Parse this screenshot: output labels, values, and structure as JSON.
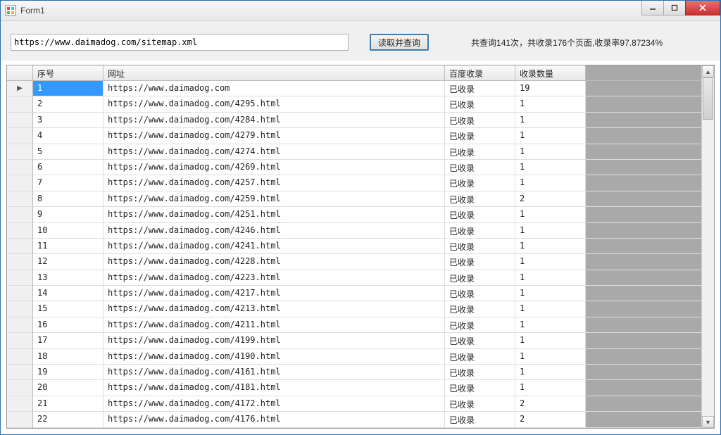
{
  "window": {
    "title": "Form1"
  },
  "toolbar": {
    "url_value": "https://www.daimadog.com/sitemap.xml",
    "read_btn": "读取并查询",
    "status": "共查询141次，共收录176个页面,收录率97.87234%"
  },
  "grid": {
    "headers": {
      "idx": "序号",
      "url": "网址",
      "status": "百度收录",
      "count": "收录数量"
    },
    "rows": [
      {
        "idx": "1",
        "url": "https://www.daimadog.com",
        "status": "已收录",
        "count": "19",
        "selected": true
      },
      {
        "idx": "2",
        "url": "https://www.daimadog.com/4295.html",
        "status": "已收录",
        "count": "1"
      },
      {
        "idx": "3",
        "url": "https://www.daimadog.com/4284.html",
        "status": "已收录",
        "count": "1"
      },
      {
        "idx": "4",
        "url": "https://www.daimadog.com/4279.html",
        "status": "已收录",
        "count": "1"
      },
      {
        "idx": "5",
        "url": "https://www.daimadog.com/4274.html",
        "status": "已收录",
        "count": "1"
      },
      {
        "idx": "6",
        "url": "https://www.daimadog.com/4269.html",
        "status": "已收录",
        "count": "1"
      },
      {
        "idx": "7",
        "url": "https://www.daimadog.com/4257.html",
        "status": "已收录",
        "count": "1"
      },
      {
        "idx": "8",
        "url": "https://www.daimadog.com/4259.html",
        "status": "已收录",
        "count": "2"
      },
      {
        "idx": "9",
        "url": "https://www.daimadog.com/4251.html",
        "status": "已收录",
        "count": "1"
      },
      {
        "idx": "10",
        "url": "https://www.daimadog.com/4246.html",
        "status": "已收录",
        "count": "1"
      },
      {
        "idx": "11",
        "url": "https://www.daimadog.com/4241.html",
        "status": "已收录",
        "count": "1"
      },
      {
        "idx": "12",
        "url": "https://www.daimadog.com/4228.html",
        "status": "已收录",
        "count": "1"
      },
      {
        "idx": "13",
        "url": "https://www.daimadog.com/4223.html",
        "status": "已收录",
        "count": "1"
      },
      {
        "idx": "14",
        "url": "https://www.daimadog.com/4217.html",
        "status": "已收录",
        "count": "1"
      },
      {
        "idx": "15",
        "url": "https://www.daimadog.com/4213.html",
        "status": "已收录",
        "count": "1"
      },
      {
        "idx": "16",
        "url": "https://www.daimadog.com/4211.html",
        "status": "已收录",
        "count": "1"
      },
      {
        "idx": "17",
        "url": "https://www.daimadog.com/4199.html",
        "status": "已收录",
        "count": "1"
      },
      {
        "idx": "18",
        "url": "https://www.daimadog.com/4190.html",
        "status": "已收录",
        "count": "1"
      },
      {
        "idx": "19",
        "url": "https://www.daimadog.com/4161.html",
        "status": "已收录",
        "count": "1"
      },
      {
        "idx": "20",
        "url": "https://www.daimadog.com/4181.html",
        "status": "已收录",
        "count": "1"
      },
      {
        "idx": "21",
        "url": "https://www.daimadog.com/4172.html",
        "status": "已收录",
        "count": "2"
      },
      {
        "idx": "22",
        "url": "https://www.daimadog.com/4176.html",
        "status": "已收录",
        "count": "2"
      }
    ]
  }
}
